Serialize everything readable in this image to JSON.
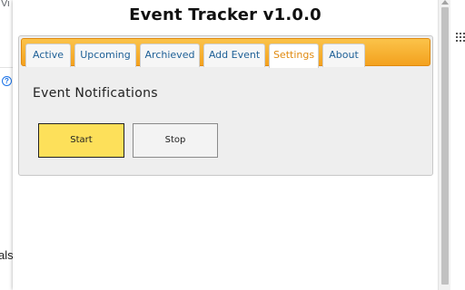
{
  "background": {
    "tab_fragment": "Vi",
    "text_fragment": "als"
  },
  "popup": {
    "title": "Event Tracker v1.0.0",
    "tabs": [
      {
        "label": "Active",
        "active": false
      },
      {
        "label": "Upcoming",
        "active": false
      },
      {
        "label": "Archieved",
        "active": false
      },
      {
        "label": "Add Event",
        "active": false
      },
      {
        "label": "Settings",
        "active": true
      },
      {
        "label": "About",
        "active": false
      }
    ],
    "section_heading": "Event Notifications",
    "buttons": {
      "start_label": "Start",
      "stop_label": "Stop"
    }
  },
  "colors": {
    "tabbar": "#f5a623",
    "tab_text": "#1d5f96",
    "active_tab_text": "#e08a10",
    "start_button": "#fde05a",
    "panel_bg": "#eeeeee"
  },
  "icons": [
    "help-circle-icon",
    "apps-grid-icon",
    "close-icon"
  ]
}
